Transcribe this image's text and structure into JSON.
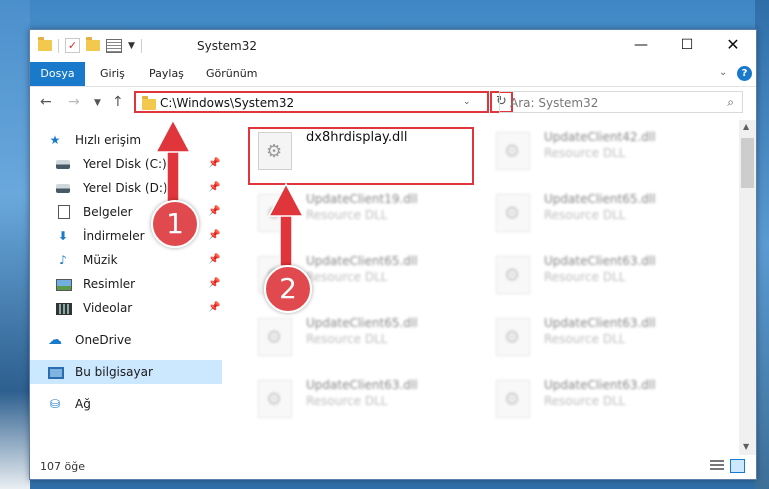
{
  "window": {
    "title": "System32",
    "minimize": "—",
    "maximize": "☐",
    "close": "✕"
  },
  "ribbon": {
    "tabs": [
      "Dosya",
      "Giriş",
      "Paylaş",
      "Görünüm"
    ],
    "help": "?"
  },
  "nav": {
    "address": "C:\\Windows\\System32",
    "search_placeholder": "Ara: System32"
  },
  "sidebar": {
    "items": [
      {
        "label": "Hızlı erişim",
        "pinned": false
      },
      {
        "label": "Yerel Disk (C:)",
        "pinned": true
      },
      {
        "label": "Yerel Disk (D:)",
        "pinned": true
      },
      {
        "label": "Belgeler",
        "pinned": true
      },
      {
        "label": "İndirmeler",
        "pinned": true
      },
      {
        "label": "Müzik",
        "pinned": true
      },
      {
        "label": "Resimler",
        "pinned": true
      },
      {
        "label": "Videolar",
        "pinned": true
      },
      {
        "label": "OneDrive",
        "pinned": false
      },
      {
        "label": "Bu bilgisayar",
        "pinned": false,
        "selected": true
      },
      {
        "label": "Ağ",
        "pinned": false
      }
    ]
  },
  "files": [
    {
      "name": "dx8hrdisplay.dll",
      "type": ""
    },
    {
      "name": "UpdateClient42.dll",
      "type": "Resource DLL"
    },
    {
      "name": "UpdateClient19.dll",
      "type": "Resource DLL"
    },
    {
      "name": "UpdateClient65.dll",
      "type": "Resource DLL"
    },
    {
      "name": "UpdateClient65.dll",
      "type": "Resource DLL"
    },
    {
      "name": "UpdateClient63.dll",
      "type": "Resource DLL"
    },
    {
      "name": "UpdateClient65.dll",
      "type": "Resource DLL"
    },
    {
      "name": "UpdateClient63.dll",
      "type": "Resource DLL"
    },
    {
      "name": "UpdateClient63.dll",
      "type": "Resource DLL"
    },
    {
      "name": "UpdateClient63.dll",
      "type": "Resource DLL"
    }
  ],
  "status": {
    "item_count": "107 öğe"
  },
  "annotations": [
    "1",
    "2"
  ],
  "colors": {
    "accent": "#1979ca",
    "highlight": "#e0353a",
    "selection": "#cce8ff"
  }
}
